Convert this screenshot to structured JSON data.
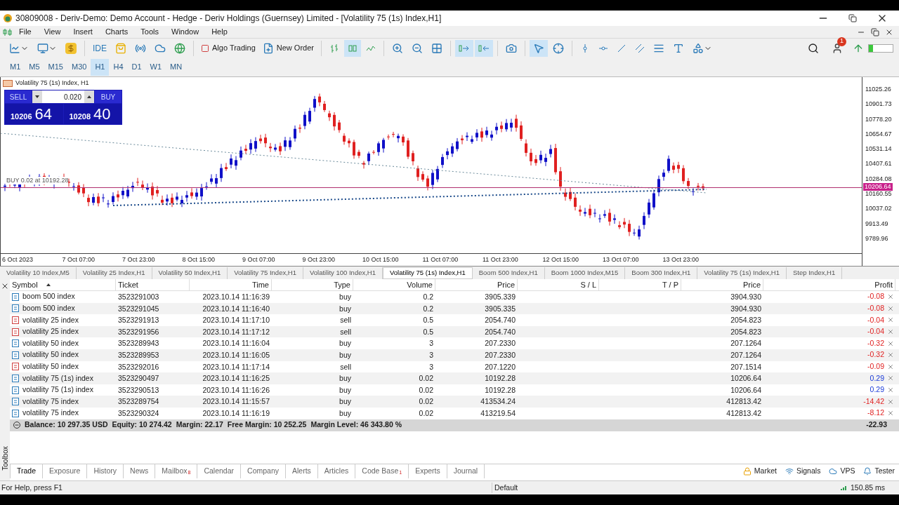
{
  "window": {
    "title": "30809008 - Deriv-Demo: Demo Account - Hedge - Deriv Holdings (Guernsey) Limited - [Volatility 75 (1s) Index,H1]"
  },
  "menu": [
    "File",
    "View",
    "Insert",
    "Charts",
    "Tools",
    "Window",
    "Help"
  ],
  "toolbar": {
    "ide": "IDE",
    "algo_trading": "Algo Trading",
    "new_order": "New Order",
    "chart_modes": [
      {
        "selected": false
      },
      {
        "selected": true
      },
      {
        "selected": false
      }
    ],
    "auto_scroll": true,
    "chart_shift": true,
    "drawing_tools": [
      {
        "selected": true
      },
      {
        "selected": false
      }
    ],
    "notifications": "1"
  },
  "timeframes": [
    {
      "label": "M1",
      "selected": false
    },
    {
      "label": "M5",
      "selected": false
    },
    {
      "label": "M15",
      "selected": false
    },
    {
      "label": "M30",
      "selected": false
    },
    {
      "label": "H1",
      "selected": true
    },
    {
      "label": "H4",
      "selected": false
    },
    {
      "label": "D1",
      "selected": false
    },
    {
      "label": "W1",
      "selected": false
    },
    {
      "label": "MN",
      "selected": false
    }
  ],
  "chart": {
    "title": "Volatility 75 (1s) Index, H1",
    "one_click": {
      "sell": "SELL",
      "buy": "BUY",
      "volume": "0.020",
      "bid_big": "10206",
      "bid_small": "64",
      "ask_big": "10208",
      "ask_small": "40"
    },
    "position_label": "BUY 0.02 at 10192.28",
    "price_labels": [
      "11025.26",
      "10901.73",
      "10778.20",
      "10654.67",
      "10531.14",
      "10407.61",
      "10284.08",
      "10160.55",
      "10037.02",
      "9913.49",
      "9789.96"
    ],
    "current_price": "10206.64",
    "time_labels": [
      "6 Oct 2023",
      "7 Oct 07:00",
      "7 Oct 23:00",
      "8 Oct 15:00",
      "9 Oct 07:00",
      "9 Oct 23:00",
      "10 Oct 15:00",
      "11 Oct 07:00",
      "11 Oct 23:00",
      "12 Oct 15:00",
      "13 Oct 07:00",
      "13 Oct 23:00"
    ]
  },
  "chart_tabs": [
    {
      "label": "Volatility 10 Index,M5",
      "selected": false
    },
    {
      "label": "Volatility 25 Index,H1",
      "selected": false
    },
    {
      "label": "Volatility 50 Index,H1",
      "selected": false
    },
    {
      "label": "Volatility 75 Index,H1",
      "selected": false
    },
    {
      "label": "Volatility 100 Index,H1",
      "selected": false
    },
    {
      "label": "Volatility 75 (1s) Index,H1",
      "selected": true
    },
    {
      "label": "Boom 500 Index,H1",
      "selected": false
    },
    {
      "label": "Boom 1000 Index,M15",
      "selected": false
    },
    {
      "label": "Boom 300 Index,H1",
      "selected": false
    },
    {
      "label": "Volatility 75 (1s) Index,H1",
      "selected": false
    },
    {
      "label": "Step Index,H1",
      "selected": false
    }
  ],
  "table": {
    "columns": [
      "Symbol",
      "Ticket",
      "Time",
      "Type",
      "Volume",
      "Price",
      "S / L",
      "T / P",
      "Price",
      "Profit"
    ],
    "rows": [
      {
        "kind": "buy",
        "gain": false,
        "cells": [
          "boom 500 index",
          "3523291003",
          "2023.10.14 11:16:39",
          "buy",
          "0.2",
          "3905.339",
          "",
          "",
          "3904.930",
          "-0.08"
        ]
      },
      {
        "kind": "buy",
        "gain": false,
        "cells": [
          "boom 500 index",
          "3523291045",
          "2023.10.14 11:16:40",
          "buy",
          "0.2",
          "3905.335",
          "",
          "",
          "3904.930",
          "-0.08"
        ]
      },
      {
        "kind": "sell",
        "gain": false,
        "cells": [
          "volatility 25 index",
          "3523291913",
          "2023.10.14 11:17:10",
          "sell",
          "0.5",
          "2054.740",
          "",
          "",
          "2054.823",
          "-0.04"
        ]
      },
      {
        "kind": "sell",
        "gain": false,
        "cells": [
          "volatility 25 index",
          "3523291956",
          "2023.10.14 11:17:12",
          "sell",
          "0.5",
          "2054.740",
          "",
          "",
          "2054.823",
          "-0.04"
        ]
      },
      {
        "kind": "buy",
        "gain": false,
        "cells": [
          "volatility 50 index",
          "3523289943",
          "2023.10.14 11:16:04",
          "buy",
          "3",
          "207.2330",
          "",
          "",
          "207.1264",
          "-0.32"
        ]
      },
      {
        "kind": "buy",
        "gain": false,
        "cells": [
          "volatility 50 index",
          "3523289953",
          "2023.10.14 11:16:05",
          "buy",
          "3",
          "207.2330",
          "",
          "",
          "207.1264",
          "-0.32"
        ]
      },
      {
        "kind": "sell",
        "gain": false,
        "cells": [
          "volatility 50 index",
          "3523292016",
          "2023.10.14 11:17:14",
          "sell",
          "3",
          "207.1220",
          "",
          "",
          "207.1514",
          "-0.09"
        ]
      },
      {
        "kind": "buy",
        "gain": true,
        "cells": [
          "volatility 75 (1s) index",
          "3523290497",
          "2023.10.14 11:16:25",
          "buy",
          "0.02",
          "10192.28",
          "",
          "",
          "10206.64",
          "0.29"
        ]
      },
      {
        "kind": "buy",
        "gain": true,
        "cells": [
          "volatility 75 (1s) index",
          "3523290513",
          "2023.10.14 11:16:26",
          "buy",
          "0.02",
          "10192.28",
          "",
          "",
          "10206.64",
          "0.29"
        ]
      },
      {
        "kind": "buy",
        "gain": false,
        "cells": [
          "volatility 75 index",
          "3523289754",
          "2023.10.14 11:15:57",
          "buy",
          "0.02",
          "413534.24",
          "",
          "",
          "412813.42",
          "-14.42"
        ]
      },
      {
        "kind": "buy",
        "gain": false,
        "cells": [
          "volatility 75 index",
          "3523290324",
          "2023.10.14 11:16:19",
          "buy",
          "0.02",
          "413219.54",
          "",
          "",
          "412813.42",
          "-8.12"
        ]
      }
    ],
    "summary": [
      "Balance: 10 297.35 USD",
      "Equity: 10 274.42",
      "Margin: 22.17",
      "Free Margin: 10 252.25",
      "Margin Level: 46 343.80 %"
    ],
    "total": "-22.93"
  },
  "toolbox": {
    "label": "Toolbox",
    "tabs": [
      {
        "label": "Trade",
        "selected": true
      },
      {
        "label": "Exposure",
        "selected": false
      },
      {
        "label": "History",
        "selected": false
      },
      {
        "label": "News",
        "selected": false
      },
      {
        "label": "Mailbox",
        "badge": "8",
        "selected": false
      },
      {
        "label": "Calendar",
        "selected": false
      },
      {
        "label": "Company",
        "selected": false
      },
      {
        "label": "Alerts",
        "selected": false
      },
      {
        "label": "Articles",
        "selected": false
      },
      {
        "label": "Code Base",
        "badge": "1",
        "selected": false
      },
      {
        "label": "Experts",
        "selected": false
      },
      {
        "label": "Journal",
        "selected": false
      }
    ],
    "links": [
      "Market",
      "Signals",
      "VPS",
      "Tester"
    ]
  },
  "status_bar": {
    "help": "For Help, press F1",
    "profile": "Default",
    "ping": "150.85 ms"
  }
}
